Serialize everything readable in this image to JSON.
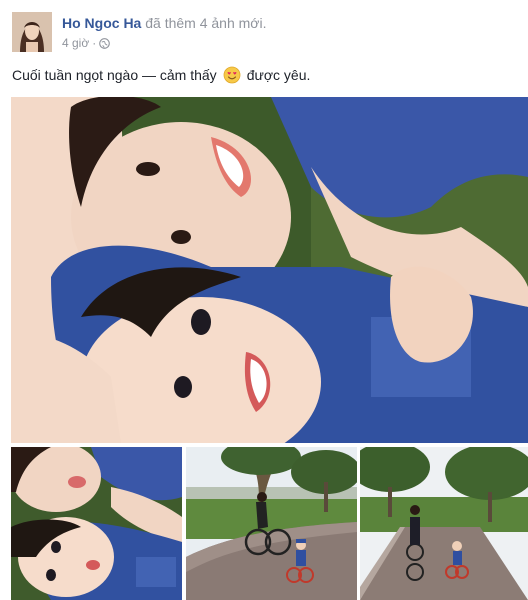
{
  "post": {
    "author": "Ho Ngoc Ha",
    "action": "đã thêm 4 ảnh mới.",
    "time": "4 giờ",
    "separator": "·",
    "privacy_icon": "globe-icon",
    "message_before": "Cuối tuần ngọt ngào — cảm thấy",
    "feeling_icon": "in-love-emoji-icon",
    "message_after": "được yêu."
  },
  "photos": [
    {
      "id": "main",
      "description_icon": "selfie-mother-son-photo"
    },
    {
      "id": "a",
      "description_icon": "selfie-closeup-photo"
    },
    {
      "id": "b",
      "description_icon": "park-biking-photo"
    },
    {
      "id": "c",
      "description_icon": "park-biking-photo-2"
    }
  ],
  "colors": {
    "author_link": "#365899",
    "meta_text": "#90949c",
    "body_text": "#1d2129"
  }
}
